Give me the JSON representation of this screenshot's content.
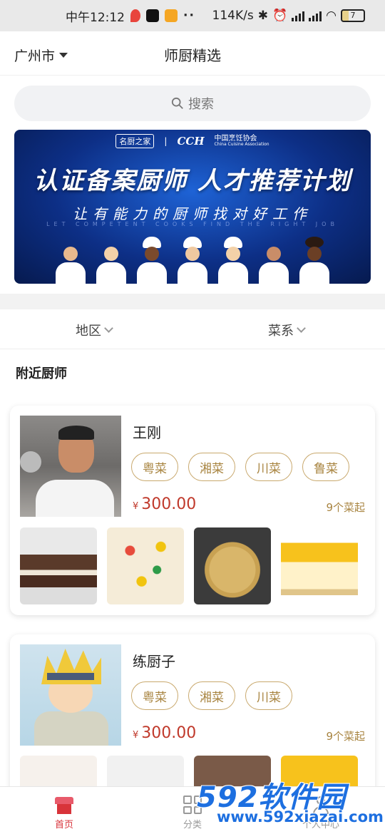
{
  "status_bar": {
    "time": "中午12:12",
    "dots": "··",
    "network_speed": "114K/s",
    "battery": "7"
  },
  "header": {
    "city": "广州市",
    "title": "师厨精选"
  },
  "search": {
    "placeholder": "搜索"
  },
  "banner": {
    "logo_left": "名厨之家",
    "logo_right": "CCH",
    "logo_right_text": "中国烹饪协会",
    "logo_right_en": "China Cuisine Association",
    "title": "认证备案厨师 人才推荐计划",
    "subtitle": "让有能力的厨师找对好工作",
    "subtitle_en": "LET COMPETENT COOKS FIND THE RIGHT JOB"
  },
  "filters": {
    "region": "地区",
    "cuisine": "菜系"
  },
  "section": {
    "title": "附近厨师"
  },
  "chefs": [
    {
      "name": "王刚",
      "tags": [
        "粤菜",
        "湘菜",
        "川菜",
        "鲁菜"
      ],
      "currency": "¥",
      "price": "300.00",
      "min_order": "9个菜起"
    },
    {
      "name": "练厨子",
      "tags": [
        "粤菜",
        "湘菜",
        "川菜"
      ],
      "currency": "¥",
      "price": "300.00",
      "min_order": "9个菜起"
    }
  ],
  "bottom_nav": {
    "home": "首页",
    "category": "分类",
    "profile": "个人中心"
  },
  "watermark": {
    "brand": "592软件园",
    "url": "www.592xiazai.com"
  },
  "colors": {
    "accent_red": "#d8333a",
    "tag_gold": "#a88440",
    "price_red": "#c0392b",
    "watermark_blue": "#1d6fe0"
  }
}
